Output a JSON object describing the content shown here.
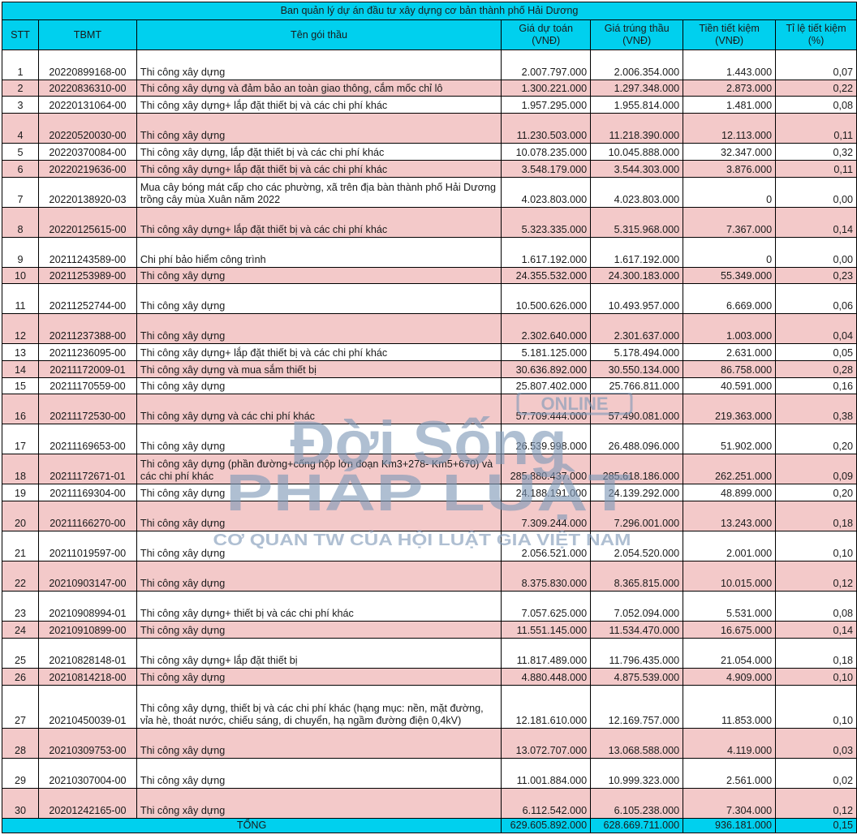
{
  "title": "Ban quản lý dự án đầu tư xây dựng cơ bản thành phố Hải Dương",
  "headers": {
    "stt": "STT",
    "tbmt": "TBMT",
    "name": "Tên gói thầu",
    "estimate": "Giá dự toán (VNĐ)",
    "award": "Giá trúng thầu (VNĐ)",
    "saving": "Tiền tiết kiệm (VNĐ)",
    "rate": "Tỉ lệ tiết kiệm (%)"
  },
  "rows": [
    {
      "stt": "1",
      "tbmt": "20220899168-00",
      "name": "Thi công xây dựng",
      "estimate": "2.007.797.000",
      "award": "2.006.354.000",
      "saving": "1.443.000",
      "rate": "0,07"
    },
    {
      "stt": "2",
      "tbmt": "20220836310-00",
      "name": "Thi công xây dựng và đảm bảo an toàn giao thông, cắm mốc chỉ lô",
      "estimate": "1.300.221.000",
      "award": "1.297.348.000",
      "saving": "2.873.000",
      "rate": "0,22"
    },
    {
      "stt": "3",
      "tbmt": "20220131064-00",
      "name": "Thi công xây dựng+ lắp đặt thiết bị và các chi phí khác",
      "estimate": "1.957.295.000",
      "award": "1.955.814.000",
      "saving": "1.481.000",
      "rate": "0,08"
    },
    {
      "stt": "4",
      "tbmt": "20220520030-00",
      "name": "Thi công xây dựng",
      "estimate": "11.230.503.000",
      "award": "11.218.390.000",
      "saving": "12.113.000",
      "rate": "0,11"
    },
    {
      "stt": "5",
      "tbmt": "20220370084-00",
      "name": "Thi công xây dựng, lắp đặt thiết bị và các chi phí khác",
      "estimate": "10.078.235.000",
      "award": "10.045.888.000",
      "saving": "32.347.000",
      "rate": "0,32"
    },
    {
      "stt": "6",
      "tbmt": "20220219636-00",
      "name": "Thi công xây dựng+ lắp đặt thiết bị và các chi phí khác",
      "estimate": "3.548.179.000",
      "award": "3.544.303.000",
      "saving": "3.876.000",
      "rate": "0,11"
    },
    {
      "stt": "7",
      "tbmt": "20220138920-03",
      "name": "Mua cây bóng mát cấp cho các phường, xã trên địa bàn thành phố Hải Dương trồng cây mùa Xuân năm 2022",
      "estimate": "4.023.803.000",
      "award": "4.023.803.000",
      "saving": "0",
      "rate": "0,00"
    },
    {
      "stt": "8",
      "tbmt": "20220125615-00",
      "name": "Thi công xây dựng+ lắp đặt thiết bị và các chi phí khác",
      "estimate": "5.323.335.000",
      "award": "5.315.968.000",
      "saving": "7.367.000",
      "rate": "0,14"
    },
    {
      "stt": "9",
      "tbmt": "20211243589-00",
      "name": "Chi phí bảo hiểm công trình",
      "estimate": "1.617.192.000",
      "award": "1.617.192.000",
      "saving": "0",
      "rate": "0,00"
    },
    {
      "stt": "10",
      "tbmt": "20211253989-00",
      "name": "Thi công xây dựng",
      "estimate": "24.355.532.000",
      "award": "24.300.183.000",
      "saving": "55.349.000",
      "rate": "0,23"
    },
    {
      "stt": "11",
      "tbmt": "20211252744-00",
      "name": "Thi công xây dựng",
      "estimate": "10.500.626.000",
      "award": "10.493.957.000",
      "saving": "6.669.000",
      "rate": "0,06"
    },
    {
      "stt": "12",
      "tbmt": "20211237388-00",
      "name": "Thi công xây dựng",
      "estimate": "2.302.640.000",
      "award": "2.301.637.000",
      "saving": "1.003.000",
      "rate": "0,04"
    },
    {
      "stt": "13",
      "tbmt": "20211236095-00",
      "name": "Thi công xây dựng+ lắp đặt thiết bị và các chi phí khác",
      "estimate": "5.181.125.000",
      "award": "5.178.494.000",
      "saving": "2.631.000",
      "rate": "0,05"
    },
    {
      "stt": "14",
      "tbmt": "20211172009-01",
      "name": "Thi công xây dựng và mua sắm thiết bị",
      "estimate": "30.636.892.000",
      "award": "30.550.134.000",
      "saving": "86.758.000",
      "rate": "0,28"
    },
    {
      "stt": "15",
      "tbmt": "20211170559-00",
      "name": "Thi công xây dựng",
      "estimate": "25.807.402.000",
      "award": "25.766.811.000",
      "saving": "40.591.000",
      "rate": "0,16"
    },
    {
      "stt": "16",
      "tbmt": "20211172530-00",
      "name": "Thi công xây dựng và các chi phí khác",
      "estimate": "57.709.444.000",
      "award": "57.490.081.000",
      "saving": "219.363.000",
      "rate": "0,38"
    },
    {
      "stt": "17",
      "tbmt": "20211169653-00",
      "name": "Thi công xây dựng",
      "estimate": "26.539.998.000",
      "award": "26.488.096.000",
      "saving": "51.902.000",
      "rate": "0,20"
    },
    {
      "stt": "18",
      "tbmt": "20211172671-01",
      "name": "Thi công xây dựng (phần đường+cống hộp lớn đoạn Km3+278- Km5+670) và các chi phí khác",
      "estimate": "285.880.437.000",
      "award": "285.618.186.000",
      "saving": "262.251.000",
      "rate": "0,09"
    },
    {
      "stt": "19",
      "tbmt": "20211169304-00",
      "name": "Thi công xây dựng",
      "estimate": "24.188.191.000",
      "award": "24.139.292.000",
      "saving": "48.899.000",
      "rate": "0,20"
    },
    {
      "stt": "20",
      "tbmt": "20211166270-00",
      "name": "Thi công xây dựng",
      "estimate": "7.309.244.000",
      "award": "7.296.001.000",
      "saving": "13.243.000",
      "rate": "0,18"
    },
    {
      "stt": "21",
      "tbmt": "20211019597-00",
      "name": "Thi công xây dựng",
      "estimate": "2.056.521.000",
      "award": "2.054.520.000",
      "saving": "2.001.000",
      "rate": "0,10"
    },
    {
      "stt": "22",
      "tbmt": "20210903147-00",
      "name": "Thi công xây dựng",
      "estimate": "8.375.830.000",
      "award": "8.365.815.000",
      "saving": "10.015.000",
      "rate": "0,12"
    },
    {
      "stt": "23",
      "tbmt": "20210908994-01",
      "name": "Thi công xây dựng+ thiết bị và các chi phí khác",
      "estimate": "7.057.625.000",
      "award": "7.052.094.000",
      "saving": "5.531.000",
      "rate": "0,08"
    },
    {
      "stt": "24",
      "tbmt": "20210910899-00",
      "name": "Thi công xây dựng",
      "estimate": "11.551.145.000",
      "award": "11.534.470.000",
      "saving": "16.675.000",
      "rate": "0,14"
    },
    {
      "stt": "25",
      "tbmt": "20210828148-01",
      "name": "Thi công xây dựng+ lắp đặt thiết bị",
      "estimate": "11.817.489.000",
      "award": "11.796.435.000",
      "saving": "21.054.000",
      "rate": "0,18"
    },
    {
      "stt": "26",
      "tbmt": "20210814218-00",
      "name": "Thi công xây dựng",
      "estimate": "4.880.448.000",
      "award": "4.875.539.000",
      "saving": "4.909.000",
      "rate": "0,10"
    },
    {
      "stt": "27",
      "tbmt": "20210450039-01",
      "name": "Thi công xây dựng, thiết bị và các chi phí khác (hạng mục: nền, mặt đường, vỉa hè, thoát nước, chiếu sáng, di chuyển, hạ ngầm đường điện 0,4kV)",
      "estimate": "12.181.610.000",
      "award": "12.169.757.000",
      "saving": "11.853.000",
      "rate": "0,10"
    },
    {
      "stt": "28",
      "tbmt": "20210309753-00",
      "name": "Thi công xây dựng",
      "estimate": "13.072.707.000",
      "award": "13.068.588.000",
      "saving": "4.119.000",
      "rate": "0,03"
    },
    {
      "stt": "29",
      "tbmt": "20210307004-00",
      "name": "Thi công xây dựng",
      "estimate": "11.001.884.000",
      "award": "10.999.323.000",
      "saving": "2.561.000",
      "rate": "0,02"
    },
    {
      "stt": "30",
      "tbmt": "20201242165-00",
      "name": "Thi công xây dựng",
      "estimate": "6.112.542.000",
      "award": "6.105.238.000",
      "saving": "7.304.000",
      "rate": "0,12"
    }
  ],
  "total": {
    "label": "TỔNG",
    "estimate": "629.605.892.000",
    "award": "628.669.711.000",
    "saving": "936.181.000",
    "rate": "0,15"
  },
  "watermark": {
    "online": "ONLINE",
    "line1": "Đời Sống",
    "line2": "PHÁP LUẬT",
    "line3": "CƠ QUAN TW CỦA HỘI LUẬT GIA VIỆT NAM",
    "color": "#7f99b8"
  },
  "colors": {
    "header": "#00d0ee",
    "row_alt": "#f3c9c9"
  }
}
